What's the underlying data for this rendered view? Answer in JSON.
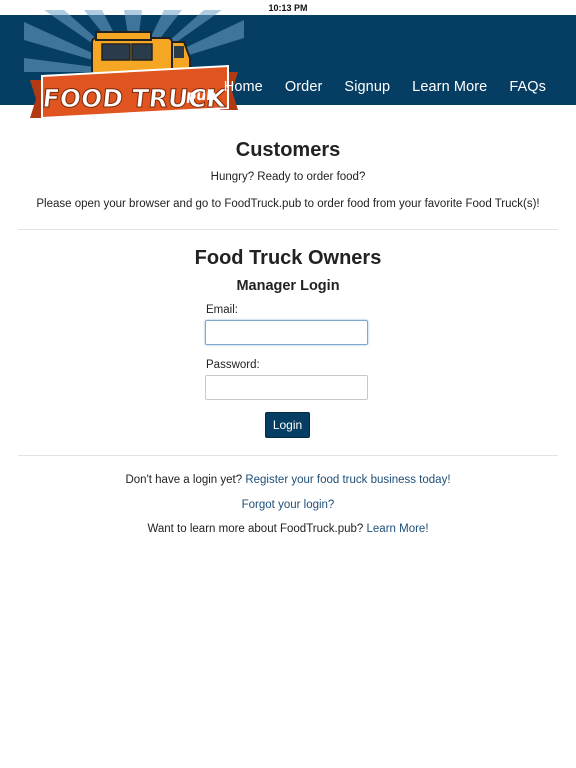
{
  "status_bar": {
    "time": "10:13 PM"
  },
  "header": {
    "logo_text": "FOOD TRUCK .pub",
    "logo_main": "FOOD TRUCK",
    "logo_suffix": ".pub",
    "nav": [
      "Home",
      "Order",
      "Signup",
      "Learn More",
      "FAQs"
    ]
  },
  "customers": {
    "title": "Customers",
    "line1": "Hungry? Ready to order food?",
    "line2": "Please open your browser and go to FoodTruck.pub to order food from your favorite Food Truck(s)!"
  },
  "owners": {
    "title": "Food Truck Owners",
    "subtitle": "Manager Login",
    "email_label": "Email:",
    "email_value": "",
    "password_label": "Password:",
    "password_value": "",
    "login_button": "Login"
  },
  "footer": {
    "register_prefix": "Don't have a login yet?",
    "register_link": "Register your food truck business today!",
    "forgot_link": "Forgot your login?",
    "learn_prefix": "Want to learn more about FoodTruck.pub?",
    "learn_link": "Learn More!"
  },
  "colors": {
    "header_bg": "#063e63",
    "banner_orange": "#e0541f",
    "truck_yellow": "#f5a623",
    "link_blue": "#1d4e78"
  }
}
